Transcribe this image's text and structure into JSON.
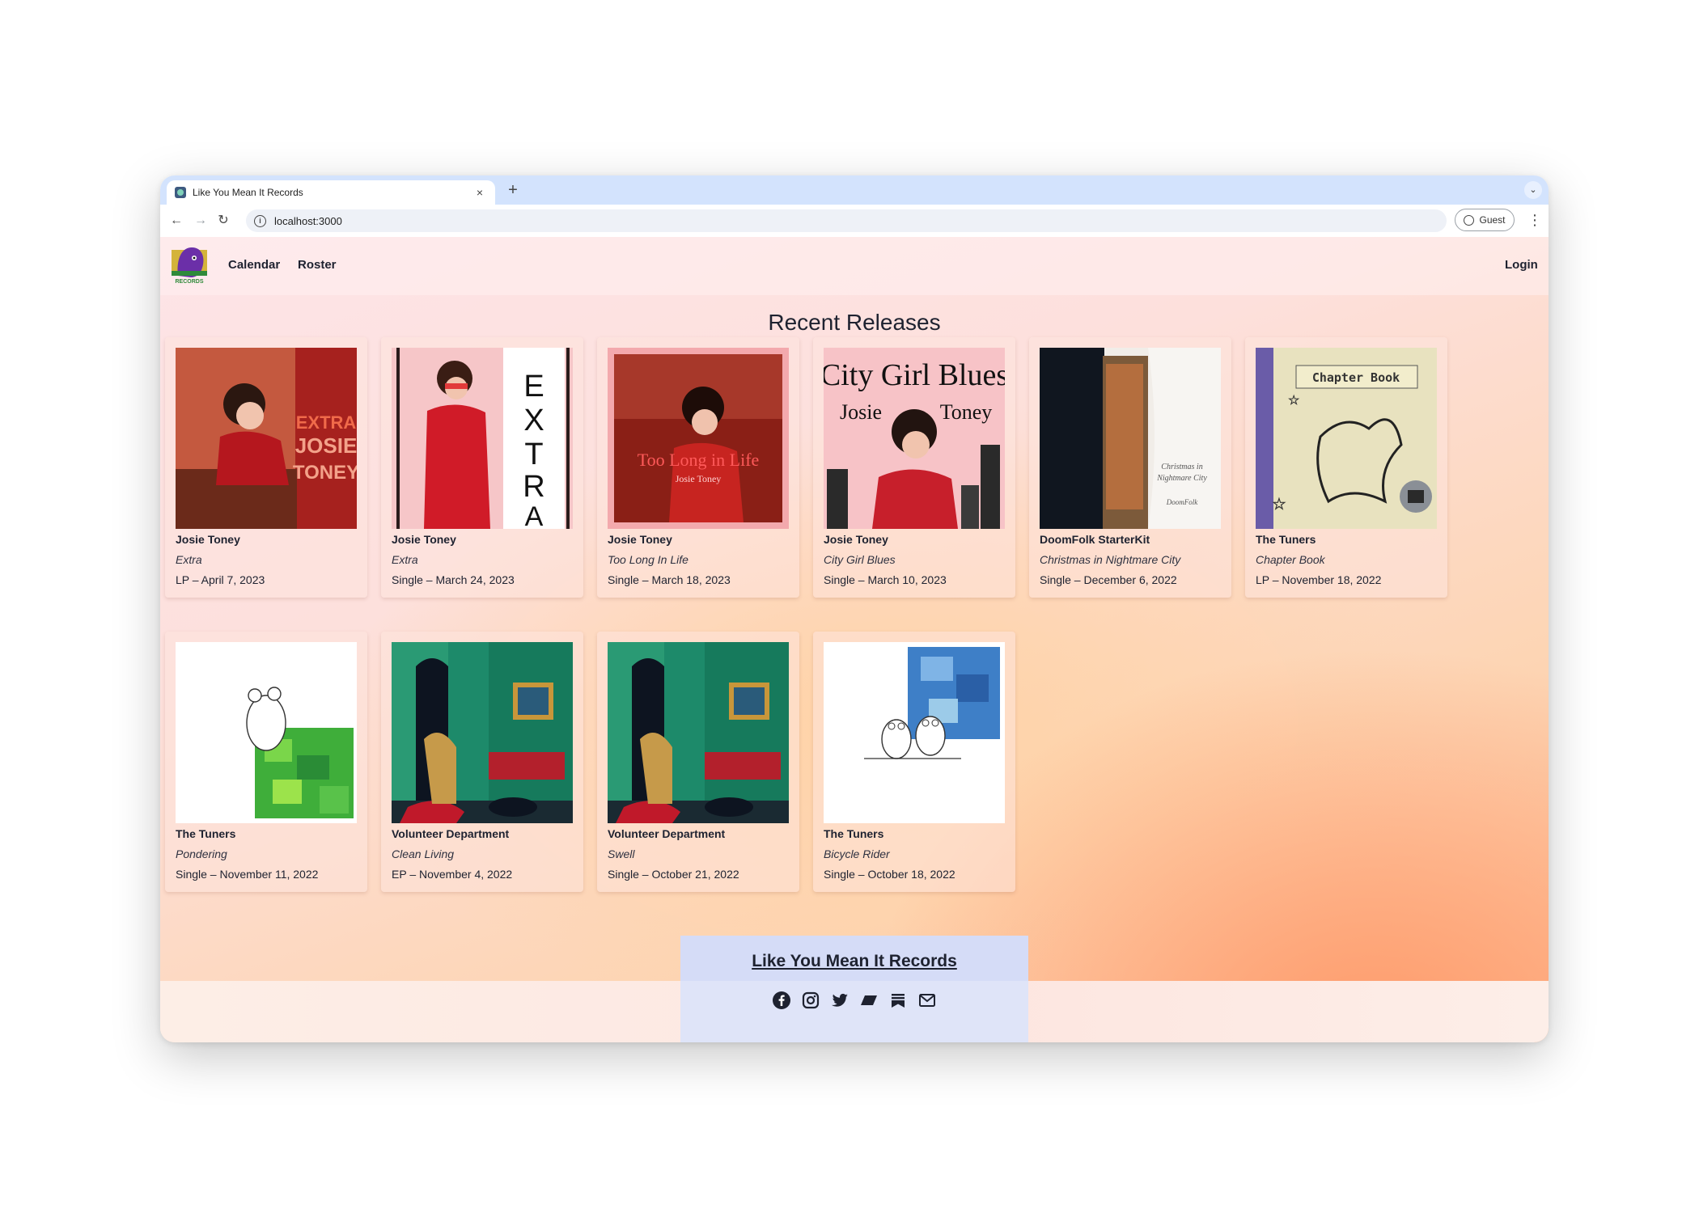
{
  "browser": {
    "tab_title": "Like You Mean It Records",
    "tab_close": "×",
    "new_tab": "+",
    "url": "localhost:3000",
    "profile_label": "Guest"
  },
  "nav": {
    "logo_text": "RECORDS",
    "links": [
      "Calendar",
      "Roster"
    ],
    "login": "Login"
  },
  "page_title": "Recent Releases",
  "releases": [
    {
      "artist": "Josie Toney",
      "title": "Extra",
      "info": "LP – April 7, 2023",
      "cover_text": "EXTRA JOSIE TONEY",
      "colors": [
        "#c74836",
        "#a31f1c"
      ]
    },
    {
      "artist": "Josie Toney",
      "title": "Extra",
      "info": "Single – March 24, 2023",
      "cover_text": "EXTRA",
      "colors": [
        "#f5c9c9",
        "#d11d2a"
      ]
    },
    {
      "artist": "Josie Toney",
      "title": "Too Long In Life",
      "info": "Single – March 18, 2023",
      "cover_text": "Too Long in Life",
      "colors": [
        "#7a1d14",
        "#d23a2a"
      ]
    },
    {
      "artist": "Josie Toney",
      "title": "City Girl Blues",
      "info": "Single – March 10, 2023",
      "cover_text": "City Girl Blues",
      "colors": [
        "#f7c2c6",
        "#c71f2b"
      ]
    },
    {
      "artist": "DoomFolk StarterKit",
      "title": "Christmas in Nightmare City",
      "info": "Single – December 6, 2022",
      "cover_text": "",
      "colors": [
        "#16202b",
        "#f1ede8"
      ]
    },
    {
      "artist": "The Tuners",
      "title": "Chapter Book",
      "info": "LP – November 18, 2022",
      "cover_text": "Chapter Book",
      "colors": [
        "#e6dfb4",
        "#6a5ca8"
      ]
    },
    {
      "artist": "The Tuners",
      "title": "Pondering",
      "info": "Single – November 11, 2022",
      "cover_text": "",
      "colors": [
        "#ffffff",
        "#3fae3a"
      ]
    },
    {
      "artist": "Volunteer Department",
      "title": "Clean Living",
      "info": "EP – November 4, 2022",
      "cover_text": "",
      "colors": [
        "#1d8a6a",
        "#b3202c"
      ]
    },
    {
      "artist": "Volunteer Department",
      "title": "Swell",
      "info": "Single – October 21, 2022",
      "cover_text": "",
      "colors": [
        "#1d8a6a",
        "#b3202c"
      ]
    },
    {
      "artist": "The Tuners",
      "title": "Bicycle Rider",
      "info": "Single – October 18, 2022",
      "cover_text": "",
      "colors": [
        "#ffffff",
        "#3e7fc7"
      ]
    }
  ],
  "footer": {
    "title": "Like You Mean It Records",
    "socials": [
      "facebook-icon",
      "instagram-icon",
      "twitter-icon",
      "bandcamp-icon",
      "substack-icon",
      "mail-icon"
    ]
  }
}
